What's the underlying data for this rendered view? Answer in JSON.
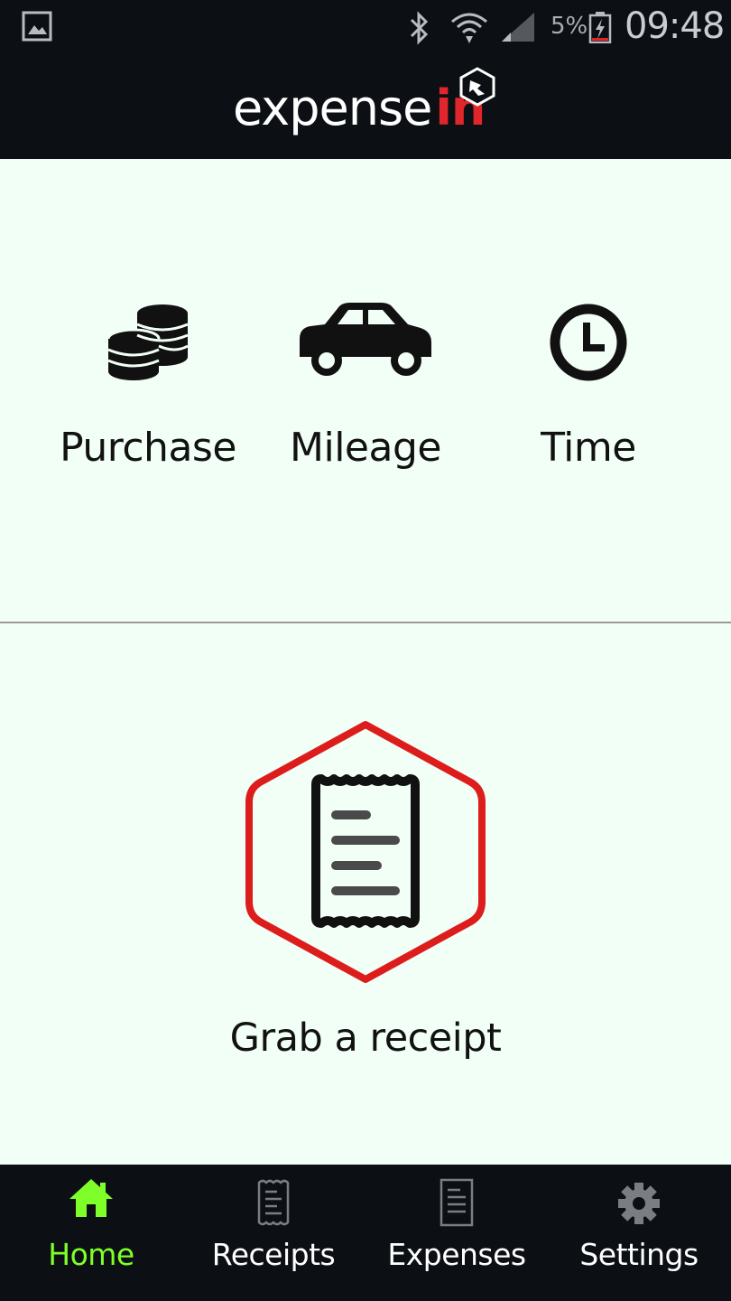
{
  "status_bar": {
    "battery_percent": "5%",
    "time": "09:48",
    "icons": [
      "gallery-icon",
      "bluetooth-icon",
      "wifi-icon",
      "signal-icon",
      "battery-charging-icon"
    ]
  },
  "header": {
    "logo_part1": "expense",
    "logo_part2": "in",
    "colors": {
      "background": "#0c1014",
      "logo_accent": "#e0262b"
    }
  },
  "actions": [
    {
      "label": "Purchase",
      "icon": "coins-icon"
    },
    {
      "label": "Mileage",
      "icon": "car-icon"
    },
    {
      "label": "Time",
      "icon": "clock-icon"
    }
  ],
  "receipt": {
    "label": "Grab a receipt",
    "icon": "receipt-icon",
    "accent": "#dd1c1c"
  },
  "bottom_nav": {
    "items": [
      {
        "label": "Home",
        "icon": "home-icon",
        "active": true
      },
      {
        "label": "Receipts",
        "icon": "receipt-icon",
        "active": false
      },
      {
        "label": "Expenses",
        "icon": "document-icon",
        "active": false
      },
      {
        "label": "Settings",
        "icon": "gear-icon",
        "active": false
      }
    ],
    "active_color": "#7fff2a"
  }
}
